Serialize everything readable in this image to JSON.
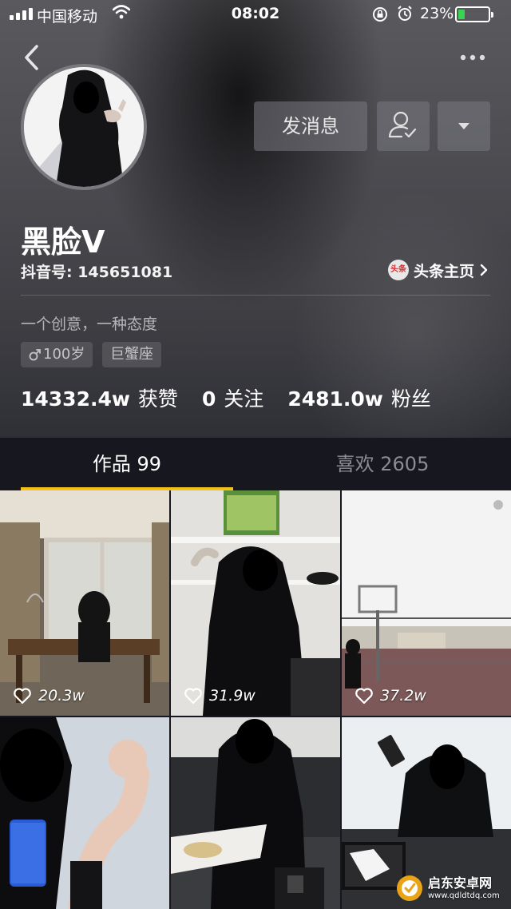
{
  "status_bar": {
    "carrier": "中国移动",
    "time": "08:02",
    "battery_percent": "23%",
    "battery_level": 0.23
  },
  "profile": {
    "nickname": "黑脸V",
    "account_id": "抖音号: 145651081",
    "toutiao_link": "头条主页",
    "toutiao_logo": "头条",
    "bio": "一个创意，一种态度",
    "tags": {
      "age": "100岁",
      "zodiac": "巨蟹座"
    },
    "stats": [
      {
        "value": "14332.4w",
        "label": "获赞"
      },
      {
        "value": "0",
        "label": "关注"
      },
      {
        "value": "2481.0w",
        "label": "粉丝"
      }
    ]
  },
  "actions": {
    "message_label": "发消息",
    "follow_icon": "person-check-icon",
    "more_dropdown_icon": "caret-down-icon"
  },
  "tabs": {
    "works": "作品 99",
    "likes": "喜欢 2605"
  },
  "videos": [
    {
      "likes": "20.3w"
    },
    {
      "likes": "31.9w"
    },
    {
      "likes": "37.2w"
    },
    {
      "likes": ""
    },
    {
      "likes": ""
    },
    {
      "likes": ""
    }
  ],
  "watermark": {
    "title": "启东安卓网",
    "url": "www.qdldtdq.com"
  },
  "colors": {
    "accent_tab_indicator": "#f2c21b",
    "background": "#16171f",
    "battery_fill": "#39d353"
  }
}
